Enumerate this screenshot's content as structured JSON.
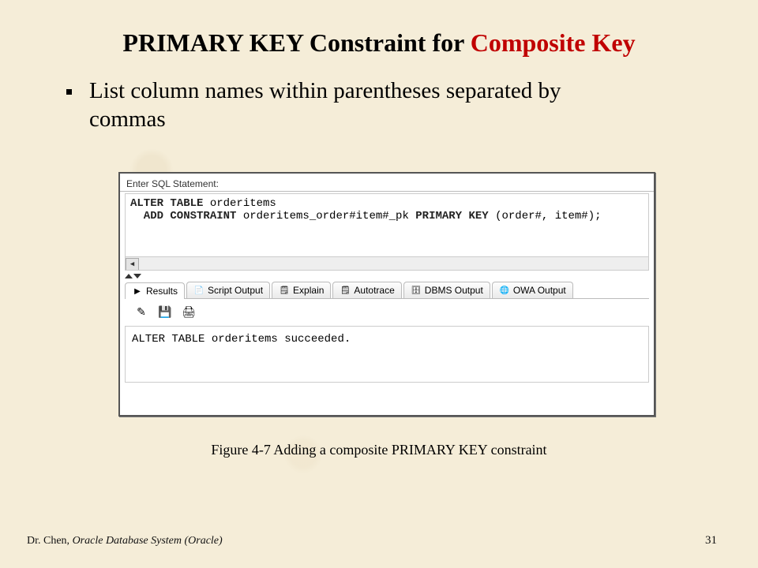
{
  "title_part1": "PRIMARY KEY Constraint for ",
  "title_part2": "Composite Key",
  "bullet": "List column names within parentheses separated by commas",
  "sql": {
    "panel_label": "Enter SQL Statement:",
    "line1_kw1": "ALTER TABLE",
    "line1_rest": " orderitems",
    "line2_kw1": "  ADD CONSTRAINT",
    "line2_mid": " orderitems_order#item#_pk ",
    "line2_kw2": "PRIMARY KEY",
    "line2_rest": " (order#, item#);"
  },
  "tabs": {
    "results": "Results",
    "script_output": "Script Output",
    "explain": "Explain",
    "autotrace": "Autotrace",
    "dbms_output": "DBMS Output",
    "owa_output": "OWA Output"
  },
  "icons": {
    "results": "▶",
    "script_output": "📄",
    "explain": "🗒",
    "autotrace": "🗒",
    "dbms_output": "🗄",
    "owa_output": "🌐",
    "pencil": "✎",
    "save": "💾",
    "print": "🖨",
    "scroll_left": "◀"
  },
  "output_text": "ALTER TABLE orderitems succeeded.",
  "caption": "Figure 4-7     Adding a composite PRIMARY KEY constraint",
  "footer_author": "Dr. Chen, ",
  "footer_book": "Oracle Database System  (Oracle)",
  "page_number": "31"
}
